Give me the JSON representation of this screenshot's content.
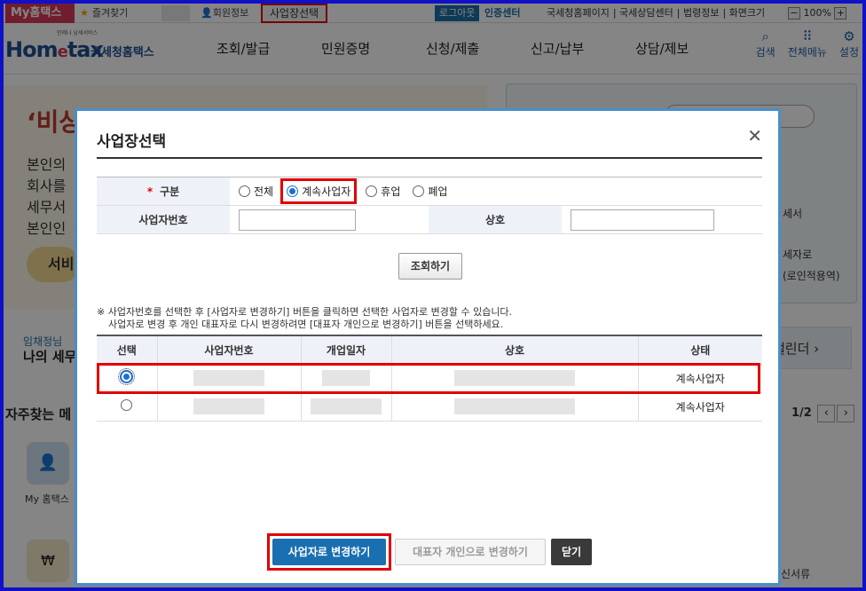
{
  "utilbar": {
    "my_hometax": "My홈택스",
    "favorites": "즐겨찾기",
    "member_info": "회원정보",
    "biz_select": "사업장선택",
    "logout": "로그아웃",
    "cert_center": "인증센터",
    "links": [
      "국세청홈페이지",
      "국세상담센터",
      "법령정보",
      "화면크기"
    ],
    "zoom_minus": "−",
    "zoom_level": "100%",
    "zoom_plus": "+"
  },
  "header": {
    "logo_slogan": "언제나 납세서비스",
    "logo_word_a": "Hom",
    "logo_word_e": "e",
    "logo_word_b": "tax",
    "logo_kor": "국세청홈택스",
    "nav": [
      "조회/발급",
      "민원증명",
      "신청/제출",
      "신고/납부",
      "상담/제보"
    ],
    "icons": [
      {
        "label": "검색",
        "icon": "search-icon"
      },
      {
        "label": "전체메뉴",
        "icon": "grid-menu-icon"
      },
      {
        "label": "설정",
        "icon": "gear-icon"
      }
    ]
  },
  "background": {
    "banner_quote": "‘비상",
    "banner_lines": [
      "본인의",
      "회사를",
      "세무서",
      "본인인"
    ],
    "banner_pill": "서비",
    "right_texts": [
      "세서",
      "세자로",
      "(로인적용역)"
    ],
    "agent_sub": "임채정님",
    "agent_title": "나의 세무",
    "calendar": "캘린더",
    "freq_title": "자주찾는 메",
    "pager": "1/2",
    "tile_label": "My 홈택스",
    "doc_label": "신서류"
  },
  "modal": {
    "title": "사업장선택",
    "close": "✕",
    "search": {
      "category_label": "구분",
      "required_mark": "*",
      "options": [
        "전체",
        "계속사업자",
        "휴업",
        "폐업"
      ],
      "selected_option": "계속사업자",
      "bizno_label": "사업자번호",
      "bizno_value": "",
      "name_label": "상호",
      "name_value": "",
      "search_button": "조회하기"
    },
    "notice_line1": "※ 사업자번호를 선택한 후 [사업자로 변경하기] 버튼을 클릭하면 선택한 사업자로 변경할 수 있습니다.",
    "notice_line2": "사업자로 변경 후 개인 대표자로 다시 변경하려면 [대표자 개인으로 변경하기] 버튼을 선택하세요.",
    "table": {
      "headers": [
        "선택",
        "사업자번호",
        "개업일자",
        "상호",
        "상태"
      ],
      "rows": [
        {
          "selected": true,
          "status": "계속사업자"
        },
        {
          "selected": false,
          "status": "계속사업자"
        }
      ]
    },
    "buttons": {
      "change_to_biz": "사업자로 변경하기",
      "change_to_personal": "대표자 개인으로 변경하기",
      "close": "닫기"
    }
  },
  "colors": {
    "frame_border": "#1010c8",
    "primary": "#1a6fb0",
    "highlight": "#e00000",
    "my_hometax": "#d73b5a"
  }
}
